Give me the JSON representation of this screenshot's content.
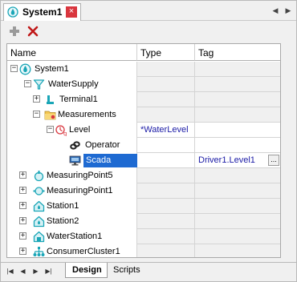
{
  "window": {
    "tab_title": "System1",
    "close_glyph": "×",
    "nav_prev": "◀",
    "nav_next": "▶"
  },
  "toolbar": {
    "add_icon": "plus-icon",
    "delete_icon": "delete-x-icon"
  },
  "grid": {
    "headers": {
      "name": "Name",
      "type": "Type",
      "tag": "Tag"
    },
    "rows": [
      {
        "label": "System1",
        "icon": "system-drop-icon",
        "type": "",
        "tag": ""
      },
      {
        "label": "WaterSupply",
        "icon": "water-supply-funnel-icon",
        "type": "",
        "tag": ""
      },
      {
        "label": "Terminal1",
        "icon": "terminal-icon",
        "type": "",
        "tag": ""
      },
      {
        "label": "Measurements",
        "icon": "folder-icon",
        "type": "",
        "tag": ""
      },
      {
        "label": "Level",
        "icon": "level-gauge-icon",
        "type": "*WaterLevel",
        "tag": ""
      },
      {
        "label": "Operator",
        "icon": "operator-link-icon",
        "type": "",
        "tag": ""
      },
      {
        "label": "Scada",
        "icon": "scada-monitor-icon",
        "type": "",
        "tag": "Driver1.Level1"
      },
      {
        "label": "MeasuringPoint5",
        "icon": "measuring-point-icon",
        "type": "",
        "tag": ""
      },
      {
        "label": "MeasuringPoint1",
        "icon": "measuring-point-flow-icon",
        "type": "",
        "tag": ""
      },
      {
        "label": "Station1",
        "icon": "station-house-icon",
        "type": "",
        "tag": ""
      },
      {
        "label": "Station2",
        "icon": "station-house-icon",
        "type": "",
        "tag": ""
      },
      {
        "label": "WaterStation1",
        "icon": "water-station-icon",
        "type": "",
        "tag": ""
      },
      {
        "label": "ConsumerCluster1",
        "icon": "consumer-cluster-icon",
        "type": "",
        "tag": ""
      }
    ],
    "expand_glyphs": {
      "collapsed": "+",
      "expanded": "−"
    },
    "ellipsis": "..."
  },
  "bottom_tabs": {
    "active": "Design",
    "inactive": "Scripts",
    "nav": [
      "|◀",
      "◀",
      "▶",
      "▶|"
    ]
  },
  "colors": {
    "selection": "#1e6ad2",
    "value_text": "#1a1aa6",
    "close_button": "#d9363e",
    "icon_teal": "#1aa6b7"
  }
}
